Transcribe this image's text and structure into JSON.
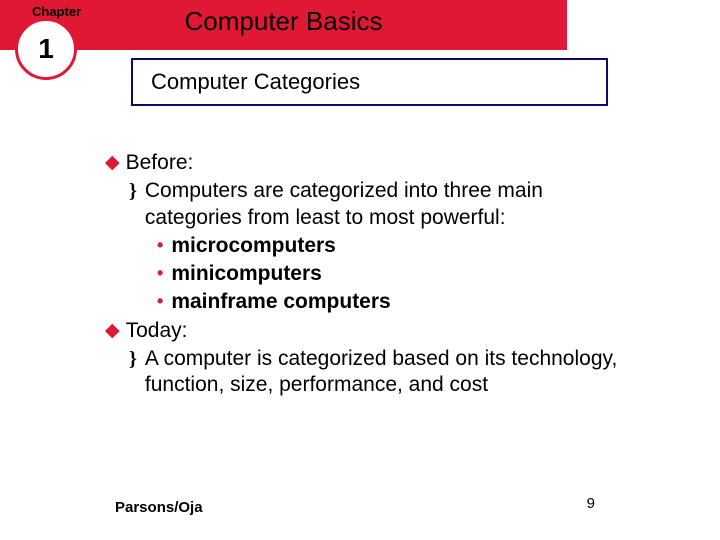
{
  "header": {
    "chapter_label": "Chapter",
    "chapter_number": "1",
    "course_title": "Computer Basics"
  },
  "subtitle": "Computer Categories",
  "body": {
    "section1": {
      "heading": "Before:",
      "desc": "Computers are categorized into three main categories from least to most powerful:",
      "items": [
        "microcomputers",
        "minicomputers",
        "mainframe computers"
      ]
    },
    "section2": {
      "heading": "Today:",
      "desc": "A computer is categorized based on its technology, function, size, performance, and cost"
    }
  },
  "footer": {
    "author": "Parsons/Oja",
    "page": "9"
  }
}
